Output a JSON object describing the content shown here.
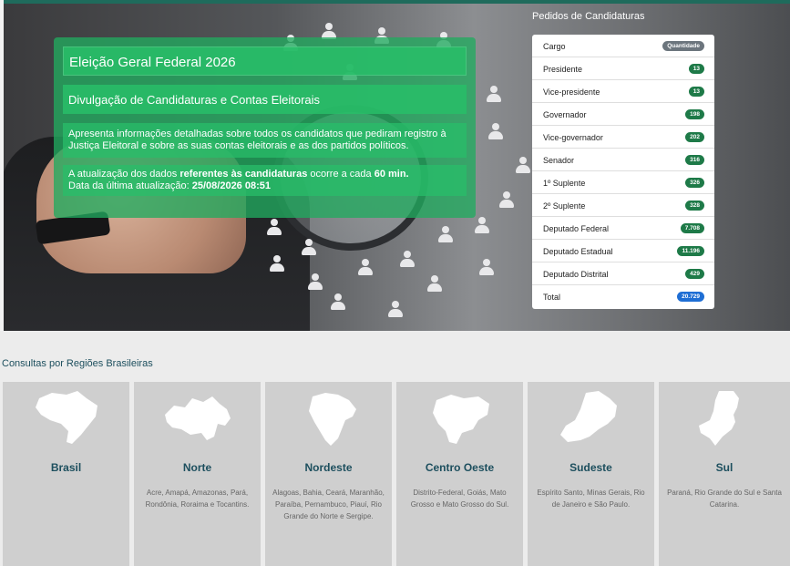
{
  "hero": {
    "title": "Eleição Geral Federal 2026",
    "subtitle": "Divulgação de Candidaturas e Contas Eleitorais",
    "description": "Apresenta informações detalhadas sobre todos os candidatos que pediram registro à Justiça Eleitoral e sobre as suas contas eleitorais e as dos partidos políticos.",
    "update_prefix": "A atualização dos dados ",
    "update_bold": "referentes às candidaturas",
    "update_middle": " ocorre a cada ",
    "update_interval": "60 min.",
    "last_update_label": "Data da última atualização: ",
    "last_update_value": "25/08/2026 08:51"
  },
  "candidaturas": {
    "title": "Pedidos de Candidaturas",
    "header": {
      "label": "Cargo",
      "value": "Quantidade"
    },
    "rows": [
      {
        "label": "Presidente",
        "value": "13"
      },
      {
        "label": "Vice-presidente",
        "value": "13"
      },
      {
        "label": "Governador",
        "value": "198"
      },
      {
        "label": "Vice-governador",
        "value": "202"
      },
      {
        "label": "Senador",
        "value": "316"
      },
      {
        "label": "1º Suplente",
        "value": "326"
      },
      {
        "label": "2º Suplente",
        "value": "328"
      },
      {
        "label": "Deputado Federal",
        "value": "7.708"
      },
      {
        "label": "Deputado Estadual",
        "value": "11.196"
      },
      {
        "label": "Deputado Distrital",
        "value": "429"
      }
    ],
    "total": {
      "label": "Total",
      "value": "20.729"
    }
  },
  "regions": {
    "title": "Consultas por Regiões Brasileiras",
    "cards": [
      {
        "name": "Brasil",
        "desc": ""
      },
      {
        "name": "Norte",
        "desc": "Acre, Amapá, Amazonas, Pará, Rondônia, Roraima e Tocantins."
      },
      {
        "name": "Nordeste",
        "desc": "Alagoas, Bahia, Ceará, Maranhão, Paraíba, Pernambuco, Piauí, Rio Grande do Norte e Sergipe."
      },
      {
        "name": "Centro Oeste",
        "desc": "Distrito-Federal, Goiás, Mato Grosso e Mato Grosso do Sul."
      },
      {
        "name": "Sudeste",
        "desc": "Espírito Santo, Minas Gerais, Rio de Janeiro e São Paulo."
      },
      {
        "name": "Sul",
        "desc": "Paraná, Rio Grande do Sul e Santa Catarina."
      }
    ]
  }
}
